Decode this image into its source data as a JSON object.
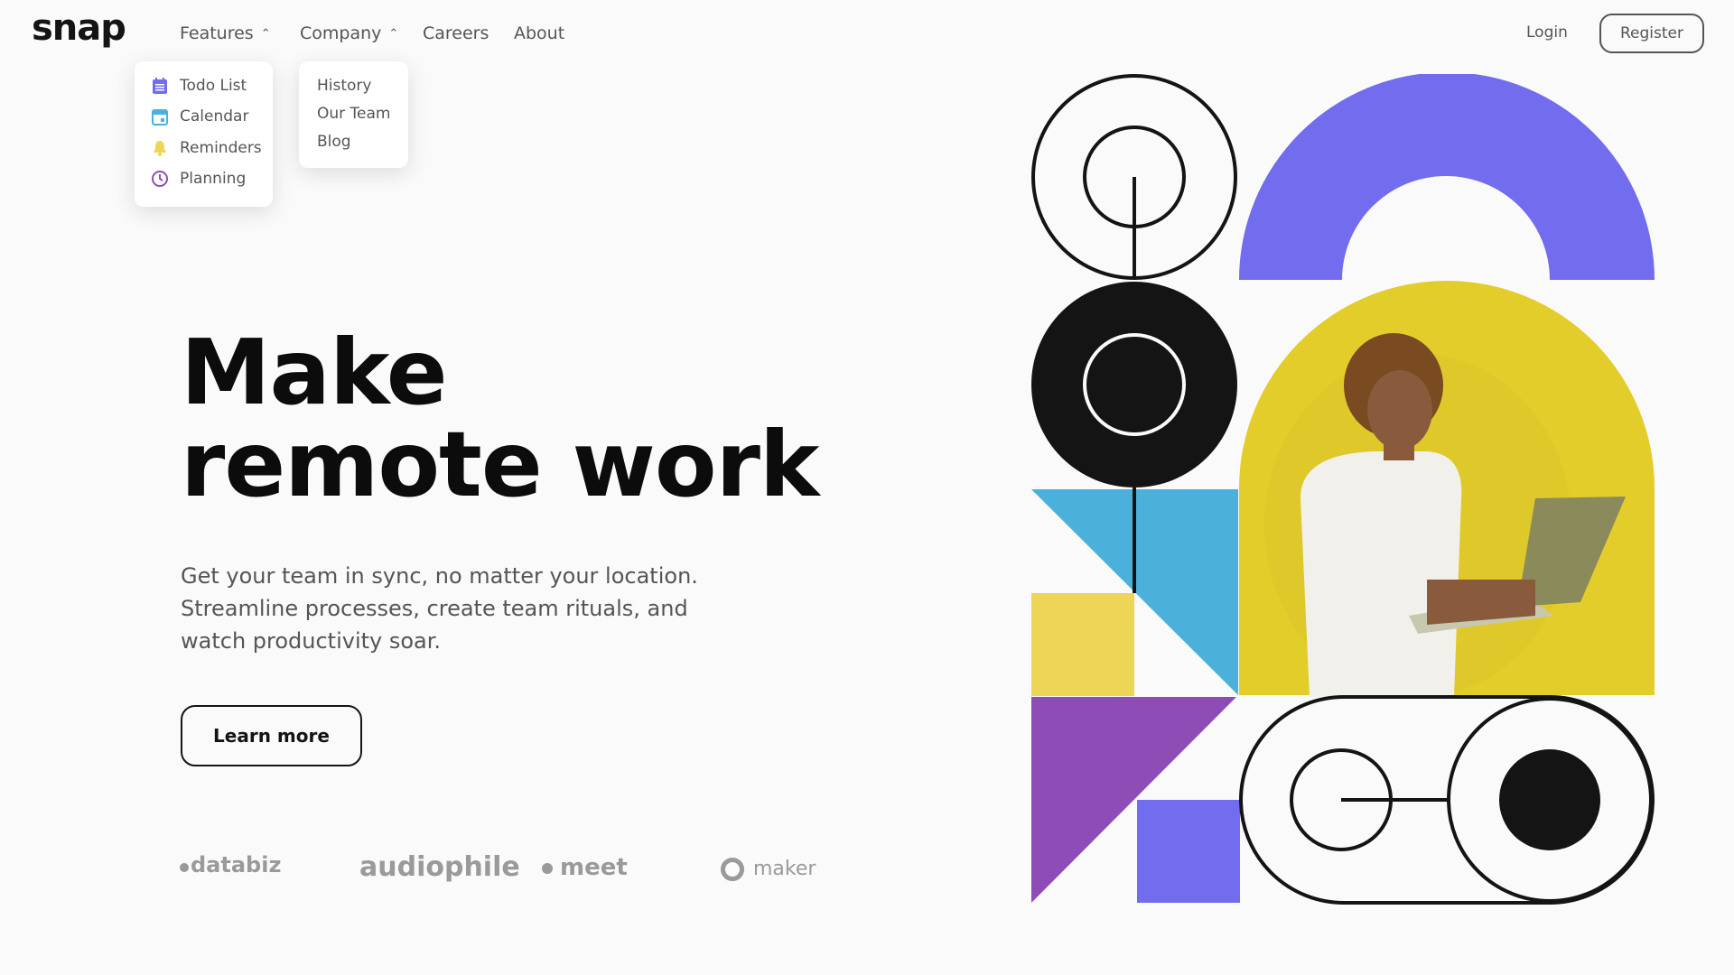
{
  "brand": {
    "logo": "snap"
  },
  "nav": {
    "features": "Features",
    "company": "Company",
    "careers": "Careers",
    "about": "About"
  },
  "auth": {
    "login": "Login",
    "register": "Register"
  },
  "features_menu": [
    {
      "label": "Todo List",
      "icon": "todo-list-icon",
      "color": "#726cee"
    },
    {
      "label": "Calendar",
      "icon": "calendar-icon",
      "color": "#4bb1da"
    },
    {
      "label": "Reminders",
      "icon": "bell-icon",
      "color": "#edd556"
    },
    {
      "label": "Planning",
      "icon": "clock-icon",
      "color": "#8e4cb6"
    }
  ],
  "company_menu": [
    "History",
    "Our Team",
    "Blog"
  ],
  "hero": {
    "title_line1": "Make",
    "title_line2": "remote work",
    "description": "Get your team in sync, no matter your location. Streamline processes, create team rituals, and watch productivity soar.",
    "cta": "Learn more"
  },
  "clients": [
    "databiz",
    "audiophile",
    "meet",
    "maker"
  ],
  "colors": {
    "purple": "#726cee",
    "blue": "#4bb1da",
    "yellow": "#edd556",
    "violet": "#8e4cb6",
    "dark": "#141414",
    "gray": "#696969"
  }
}
